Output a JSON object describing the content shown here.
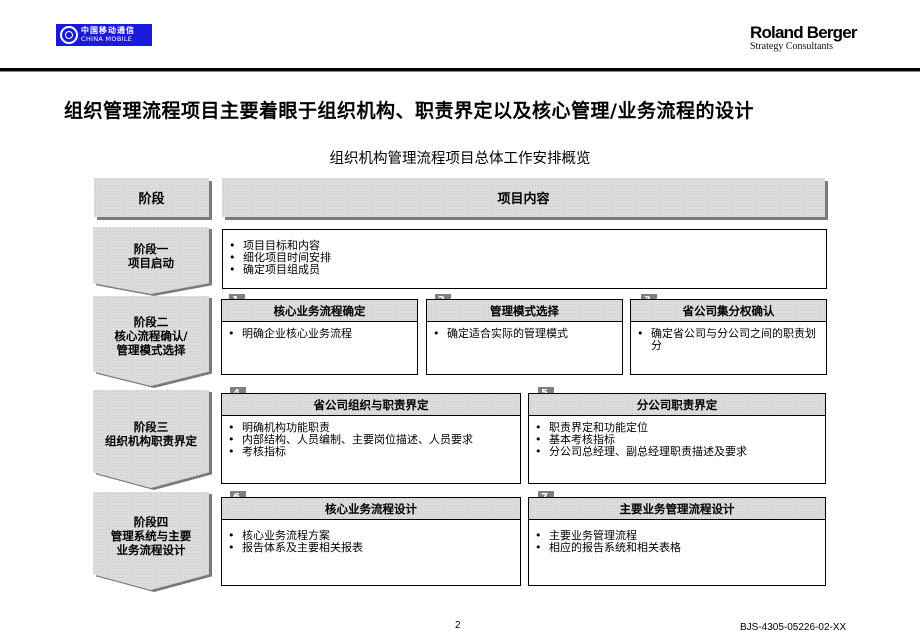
{
  "header": {
    "left_logo": {
      "icon": "china-mobile-emblem",
      "cn": "中国移动通信",
      "en": "CHINA MOBILE",
      "bg_color": "#1a1adc"
    },
    "right_logo": {
      "name": "Roland Berger",
      "sub": "Strategy Consultants"
    }
  },
  "title": "组织管理流程项目主要着眼于组织机构、职责界定以及核心管理/业务流程的设计",
  "subtitle": "组织机构管理流程项目总体工作安排概览",
  "table_headers": {
    "stage": "阶段",
    "content": "项目内容"
  },
  "stages": [
    {
      "line1": "阶段一",
      "line2": "项目启动",
      "line3": ""
    },
    {
      "line1": "阶段二",
      "line2": "核心流程确认/",
      "line3": "管理模式选择"
    },
    {
      "line1": "阶段三",
      "line2": "组织机构职责界定",
      "line3": ""
    },
    {
      "line1": "阶段四",
      "line2": "管理系统与主要",
      "line3": "业务流程设计"
    }
  ],
  "stage1_items": [
    "项目目标和内容",
    "细化项目时间安排",
    "确定项目组成员"
  ],
  "tasks": [
    {
      "num": "1",
      "title": "核心业务流程确定",
      "items": [
        "明确企业核心业务流程"
      ]
    },
    {
      "num": "2",
      "title": "管理模式选择",
      "items": [
        "确定适合实际的管理模式"
      ]
    },
    {
      "num": "3",
      "title": "省公司集分权确认",
      "items": [
        "确定省公司与分公司之间的职责划分"
      ]
    },
    {
      "num": "4",
      "title": "省公司组织与职责界定",
      "items": [
        "明确机构功能职责",
        "内部结构、人员编制、主要岗位描述、人员要求",
        "考核指标"
      ]
    },
    {
      "num": "5",
      "title": "分公司职责界定",
      "items": [
        "职责界定和功能定位",
        "基本考核指标",
        "分公司总经理、副总经理职责描述及要求"
      ]
    },
    {
      "num": "6",
      "title": "核心业务流程设计",
      "items": [
        "核心业务流程方案",
        "报告体系及主要相关报表"
      ]
    },
    {
      "num": "7",
      "title": "主要业务管理流程设计",
      "items": [
        "主要业务管理流程",
        "相应的报告系统和相关表格"
      ]
    }
  ],
  "footer": {
    "page": "2",
    "code": "BJS-4305-05226-02-XX"
  }
}
